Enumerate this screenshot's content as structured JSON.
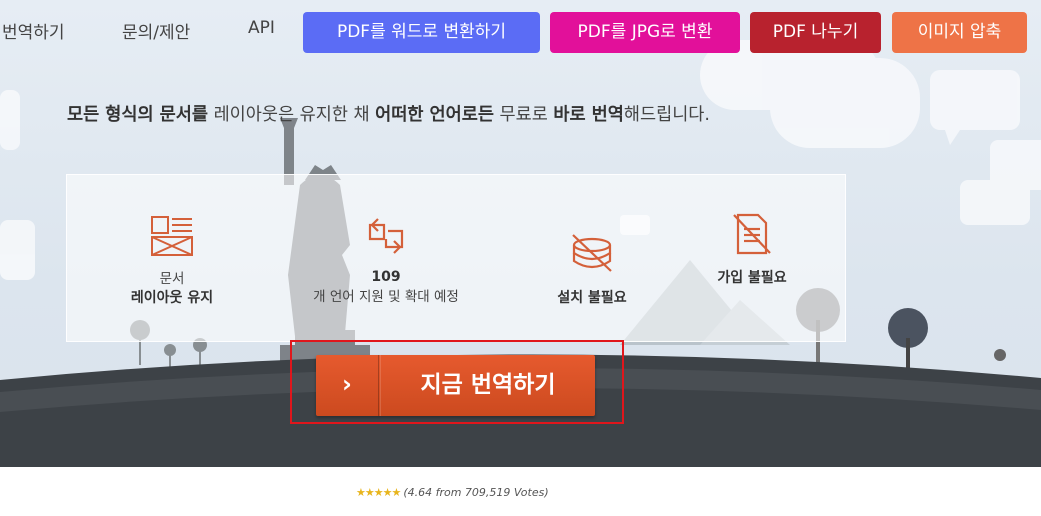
{
  "nav": {
    "links": [
      "번역하기",
      "문의/제안",
      "API"
    ],
    "buttons": [
      {
        "label": "PDF를 워드로 변환하기",
        "color": "#5b6cf5"
      },
      {
        "label": "PDF를 JPG로 변환",
        "color": "#e2109a"
      },
      {
        "label": "PDF 나누기",
        "color": "#b8222e"
      },
      {
        "label": "이미지 압축",
        "color": "#ee7347"
      }
    ]
  },
  "tagline": {
    "p1": "모든 형식의 문서를",
    "p2": " 레이아웃은 유지한 채 ",
    "p3": "어떠한 언어로든",
    "p4": " 무료로 ",
    "p5": "바로 번역",
    "p6": "해드립니다."
  },
  "features": [
    {
      "icon": "document-layout-icon",
      "line1": "문서",
      "line2": "레이아웃 유지"
    },
    {
      "icon": "translate-arrows-icon",
      "line1": "109",
      "line2": "개 언어 지원 및 확대 예정"
    },
    {
      "icon": "no-install-disk-icon",
      "line1": "설치 불필요"
    },
    {
      "icon": "no-signup-document-icon",
      "line1": "가입 불필요"
    }
  ],
  "cta": {
    "arrow": "›",
    "label": "지금 번역하기"
  },
  "rating": {
    "stars": "★★★★★",
    "text": "(4.64 from 709,519 Votes)"
  },
  "colors": {
    "accent_orange": "#d4522a",
    "highlight_red": "#e0161c",
    "icon_orange": "#d4603a"
  }
}
